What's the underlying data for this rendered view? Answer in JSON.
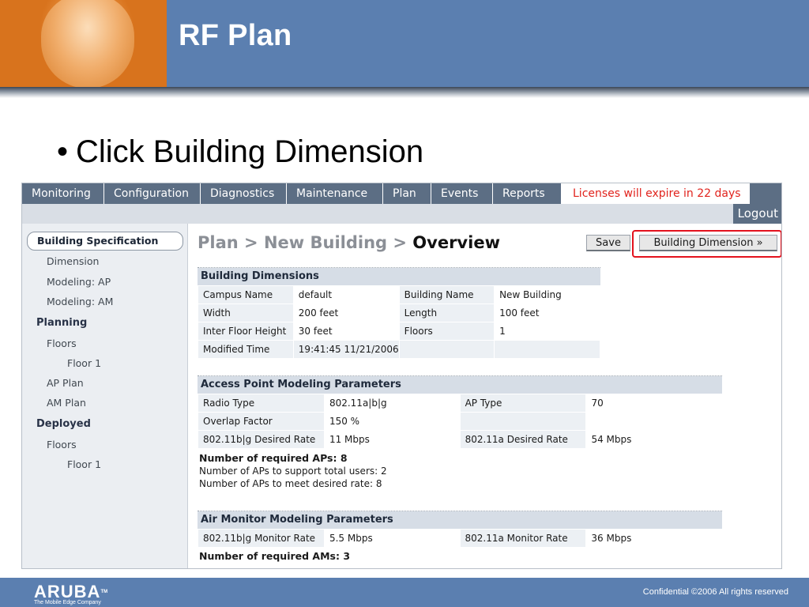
{
  "slide": {
    "title": "RF Plan",
    "bullet_symbol": "•",
    "bullet": "Click Building Dimension"
  },
  "nav": {
    "tabs": [
      "Monitoring",
      "Configuration",
      "Diagnostics",
      "Maintenance",
      "Plan",
      "Events",
      "Reports"
    ],
    "license_notice": "Licenses will expire in 22 days",
    "logout": "Logout"
  },
  "sidebar": {
    "selected": "Building Specification",
    "items": [
      "Dimension",
      "Modeling: AP",
      "Modeling: AM"
    ],
    "planning": {
      "heading": "Planning",
      "items": [
        "Floors",
        "Floor 1",
        "AP Plan",
        "AM Plan"
      ]
    },
    "deployed": {
      "heading": "Deployed",
      "items": [
        "Floors",
        "Floor 1"
      ]
    }
  },
  "breadcrumb": {
    "part1": "Plan",
    "sep": ">",
    "part2": "New Building",
    "current": "Overview"
  },
  "buttons": {
    "save": "Save",
    "building_dimension": "Building Dimension »"
  },
  "building_dimensions": {
    "title": "Building Dimensions",
    "rows": [
      [
        "Campus Name",
        "default",
        "Building Name",
        "New Building"
      ],
      [
        "Width",
        "200 feet",
        "Length",
        "100 feet"
      ],
      [
        "Inter Floor Height",
        "30 feet",
        "Floors",
        "1"
      ],
      [
        "Modified Time",
        "19:41:45 11/21/2006",
        "",
        ""
      ]
    ]
  },
  "ap_modeling": {
    "title": "Access Point Modeling Parameters",
    "rows": [
      [
        "Radio Type",
        "802.11a|b|g",
        "AP Type",
        "70"
      ],
      [
        "Overlap Factor",
        "150 %",
        "",
        ""
      ],
      [
        "802.11b|g Desired Rate",
        "11 Mbps",
        "802.11a Desired Rate",
        "54 Mbps"
      ]
    ],
    "required": "Number of required APs: 8",
    "users_line": "Number of APs to support total users: 2",
    "rate_line": "Number of APs to meet desired rate: 8"
  },
  "am_modeling": {
    "title": "Air Monitor Modeling Parameters",
    "rows": [
      [
        "802.11b|g Monitor Rate",
        "5.5 Mbps",
        "802.11a Monitor Rate",
        "36 Mbps"
      ]
    ],
    "required": "Number of required AMs: 3"
  },
  "footer": {
    "logo": "ARUBA",
    "logo_tm": "TM",
    "tagline": "The Mobile Edge Company",
    "confidential": "Confidential  ©2006 All rights reserved"
  }
}
